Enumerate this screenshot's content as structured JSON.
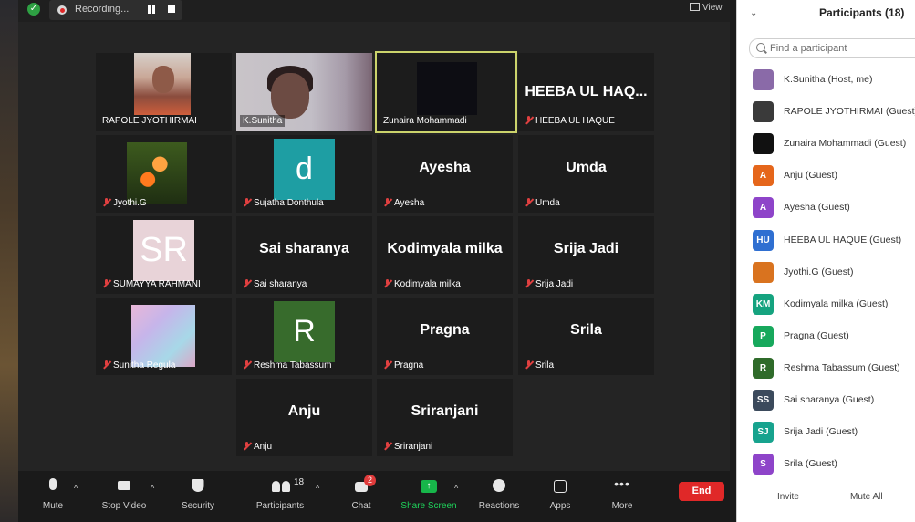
{
  "topbar": {
    "recording_label": "Recording...",
    "view_label": "View"
  },
  "tiles": [
    {
      "id": "rapole",
      "label": "RAPOLE JYOTHIRMAI",
      "muted": false,
      "kind": "photo-person1"
    },
    {
      "id": "ksunitha",
      "label": "K.Sunitha",
      "muted": false,
      "kind": "photo-person2"
    },
    {
      "id": "zunaira",
      "label": "Zunaira Mohammadi",
      "muted": false,
      "kind": "dark",
      "active": true
    },
    {
      "id": "heeba",
      "label": "HEEBA UL HAQUE",
      "bigname": "HEEBA UL HAQ...",
      "muted": true
    },
    {
      "id": "jyothi",
      "label": "Jyothi.G",
      "muted": true,
      "kind": "flower"
    },
    {
      "id": "sujatha",
      "label": "Sujatha Donthula",
      "muted": true,
      "avatar_letter": "d"
    },
    {
      "id": "ayesha",
      "label": "Ayesha",
      "bigname": "Ayesha",
      "muted": true
    },
    {
      "id": "umda",
      "label": "Umda",
      "bigname": "Umda",
      "muted": true
    },
    {
      "id": "sumayya",
      "label": "SUMAYYA RAHMANI",
      "muted": true,
      "avatar_letter": "SR"
    },
    {
      "id": "sai",
      "label": "Sai sharanya",
      "bigname": "Sai sharanya",
      "muted": true
    },
    {
      "id": "kodimyala",
      "label": "Kodimyala milka",
      "bigname": "Kodimyala milka",
      "muted": true
    },
    {
      "id": "srija",
      "label": "Srija Jadi",
      "bigname": "Srija Jadi",
      "muted": true
    },
    {
      "id": "sunitha_regula",
      "label": "Sunitha Regula",
      "muted": true,
      "kind": "pastel"
    },
    {
      "id": "reshma",
      "label": "Reshma Tabassum",
      "muted": true,
      "avatar_letter": "R"
    },
    {
      "id": "pragna",
      "label": "Pragna",
      "bigname": "Pragna",
      "muted": true
    },
    {
      "id": "srila",
      "label": "Srila",
      "bigname": "Srila",
      "muted": true
    },
    {
      "id": "anju",
      "label": "Anju",
      "bigname": "Anju",
      "muted": true
    },
    {
      "id": "sriranjani",
      "label": "Sriranjani",
      "bigname": "Sriranjani",
      "muted": true
    }
  ],
  "toolbar": {
    "mute": "Mute",
    "stop_video": "Stop Video",
    "security": "Security",
    "participants": "Participants",
    "participants_count": "18",
    "chat": "Chat",
    "chat_badge": "2",
    "share_screen": "Share Screen",
    "reactions": "Reactions",
    "apps": "Apps",
    "more": "More",
    "end": "End"
  },
  "panel": {
    "title": "Participants (18)",
    "search_placeholder": "Find a participant",
    "participants": [
      {
        "initials": "",
        "name": "K.Sunitha (Host, me)",
        "color": "#8a6aa8"
      },
      {
        "initials": "",
        "name": "RAPOLE JYOTHIRMAI (Guest)",
        "color": "#3a3a3a"
      },
      {
        "initials": "",
        "name": "Zunaira Mohammadi (Guest)",
        "color": "#111111"
      },
      {
        "initials": "A",
        "name": "Anju (Guest)",
        "color": "#e5661b"
      },
      {
        "initials": "A",
        "name": "Ayesha (Guest)",
        "color": "#8e44c9"
      },
      {
        "initials": "HU",
        "name": "HEEBA UL HAQUE (Guest)",
        "color": "#2f6fd1"
      },
      {
        "initials": "",
        "name": "Jyothi.G (Guest)",
        "color": "#d9731f"
      },
      {
        "initials": "KM",
        "name": "Kodimyala milka (Guest)",
        "color": "#15a37f"
      },
      {
        "initials": "P",
        "name": "Pragna (Guest)",
        "color": "#17a85c"
      },
      {
        "initials": "R",
        "name": "Reshma Tabassum (Guest)",
        "color": "#2f6b2a"
      },
      {
        "initials": "SS",
        "name": "Sai sharanya (Guest)",
        "color": "#3b4a5c"
      },
      {
        "initials": "SJ",
        "name": "Srija Jadi (Guest)",
        "color": "#17a38e"
      },
      {
        "initials": "S",
        "name": "Srila (Guest)",
        "color": "#8e44c9"
      }
    ],
    "invite": "Invite",
    "mute_all": "Mute All"
  }
}
